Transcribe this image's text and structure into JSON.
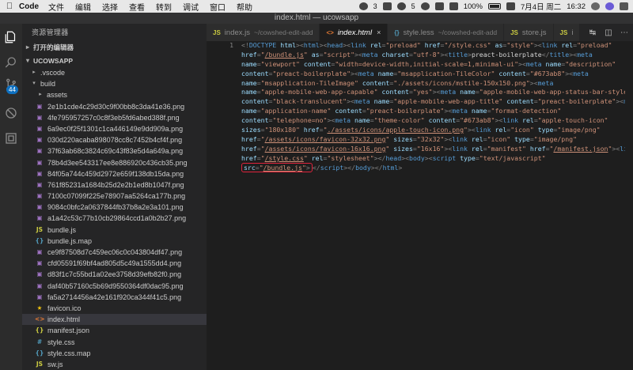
{
  "menubar": {
    "apple_icon": "apple-icon",
    "app_name": "Code",
    "items": [
      "文件",
      "编辑",
      "选择",
      "查看",
      "转到",
      "调试",
      "窗口",
      "帮助"
    ],
    "tray": {
      "qq_count": "3",
      "wechat_count": "5",
      "battery": "100%",
      "date": "7月4日 周二",
      "time": "16:32"
    }
  },
  "window": {
    "title": "index.html — ucowsapp"
  },
  "activitybar": {
    "scm_badge": "44"
  },
  "sidebar": {
    "title": "资源管理器",
    "open_editors": "打开的编辑器",
    "project": "UCOWSAPP",
    "tree": [
      {
        "label": ".vscode",
        "type": "folder",
        "depth": 1,
        "open": false
      },
      {
        "label": "build",
        "type": "folder",
        "depth": 1,
        "open": true
      },
      {
        "label": "assets",
        "type": "folder",
        "depth": 2,
        "open": false
      },
      {
        "label": "2e1b1cde4c29d30c9f00bb8c3da41e36.png",
        "type": "img",
        "depth": 2
      },
      {
        "label": "4fe795957257c0c8f3eb5fd6abed388f.png",
        "type": "img",
        "depth": 2
      },
      {
        "label": "6a9ec0f25f1301c1ca446149e9dd909a.png",
        "type": "img",
        "depth": 2
      },
      {
        "label": "030d220acaba898078cc8c7452b4cf4f.png",
        "type": "img",
        "depth": 2
      },
      {
        "label": "37f63ab68c3824c69c43f83e5d4a649a.png",
        "type": "img",
        "depth": 2
      },
      {
        "label": "78b4d3ee543317ee8e886920c436cb35.png",
        "type": "img",
        "depth": 2
      },
      {
        "label": "84f05a744c459d2972e659f138db15da.png",
        "type": "img",
        "depth": 2
      },
      {
        "label": "761f85231a1684b25d2e2b1ed8b1047f.png",
        "type": "img",
        "depth": 2
      },
      {
        "label": "7100c07099f225e78907aa5264ca177b.png",
        "type": "img",
        "depth": 2
      },
      {
        "label": "9084c0bfc2a0637844fb37b8a2e3a101.png",
        "type": "img",
        "depth": 2
      },
      {
        "label": "a1a42c53c77b10cb29864ccd1a0b2b27.png",
        "type": "img",
        "depth": 2
      },
      {
        "label": "bundle.js",
        "type": "js",
        "depth": 2
      },
      {
        "label": "bundle.js.map",
        "type": "map",
        "depth": 2
      },
      {
        "label": "ce9f87508d7c459ec06c0c043804df47.png",
        "type": "img",
        "depth": 2
      },
      {
        "label": "cfd05591f69bf4ad805d5c49a1555dd4.png",
        "type": "img",
        "depth": 2
      },
      {
        "label": "d83f1c7c55bd1a02ee3758d39efb82f0.png",
        "type": "img",
        "depth": 2
      },
      {
        "label": "daf40b57160c5b69d9550364df0dac95.png",
        "type": "img",
        "depth": 2
      },
      {
        "label": "fa5a2714456a42e161f920ca344f41c5.png",
        "type": "img",
        "depth": 2
      },
      {
        "label": "favicon.ico",
        "type": "star",
        "depth": 2
      },
      {
        "label": "index.html",
        "type": "html",
        "depth": 2,
        "selected": true
      },
      {
        "label": "manifest.json",
        "type": "json",
        "depth": 2
      },
      {
        "label": "style.css",
        "type": "css",
        "depth": 2
      },
      {
        "label": "style.css.map",
        "type": "map",
        "depth": 2
      },
      {
        "label": "sw.js",
        "type": "js",
        "depth": 2
      }
    ]
  },
  "tabs": [
    {
      "label": "index.js",
      "desc": "~/cowshed-edit-add",
      "icon": "JS",
      "active": false
    },
    {
      "label": "index.html",
      "desc": "",
      "icon": "<>",
      "active": true
    },
    {
      "label": "style.less",
      "desc": "~/cowshed-edit-add",
      "icon": "{}",
      "active": false
    },
    {
      "label": "store.js",
      "desc": "",
      "icon": "JS",
      "active": false
    },
    {
      "label": "i",
      "desc": "",
      "icon": "JS",
      "active": false
    }
  ],
  "editor": {
    "line_number": "1",
    "code_lines": [
      [
        [
          "p",
          "<!"
        ],
        [
          "t",
          "DOCTYPE"
        ],
        [
          "a",
          " html"
        ],
        [
          "p",
          ">"
        ],
        [
          "p",
          "<"
        ],
        [
          "t",
          "html"
        ],
        [
          "p",
          ">"
        ],
        [
          "p",
          "<"
        ],
        [
          "t",
          "head"
        ],
        [
          "p",
          ">"
        ],
        [
          "p",
          "<"
        ],
        [
          "t",
          "link"
        ],
        [
          "a",
          " rel"
        ],
        [
          "p",
          "="
        ],
        [
          "s",
          "\"preload\""
        ],
        [
          "a",
          " href"
        ],
        [
          "p",
          "="
        ],
        [
          "s",
          "\"/style.css\""
        ],
        [
          "a",
          " as"
        ],
        [
          "p",
          "="
        ],
        [
          "s",
          "\"style\""
        ],
        [
          "p",
          ">"
        ],
        [
          "p",
          "<"
        ],
        [
          "t",
          "link"
        ],
        [
          "a",
          " rel"
        ],
        [
          "p",
          "="
        ],
        [
          "s",
          "\"preload\""
        ]
      ],
      [
        [
          "a",
          "href"
        ],
        [
          "p",
          "="
        ],
        [
          "s",
          "\""
        ],
        [
          "u",
          "/bundle.js"
        ],
        [
          "s",
          "\""
        ],
        [
          "a",
          " as"
        ],
        [
          "p",
          "="
        ],
        [
          "s",
          "\"script\""
        ],
        [
          "p",
          ">"
        ],
        [
          "p",
          "<"
        ],
        [
          "t",
          "meta"
        ],
        [
          "a",
          " charset"
        ],
        [
          "p",
          "="
        ],
        [
          "s",
          "\"utf-8\""
        ],
        [
          "p",
          ">"
        ],
        [
          "p",
          "<"
        ],
        [
          "t",
          "title"
        ],
        [
          "p",
          ">"
        ],
        [
          "d",
          "preact-boilerplate"
        ],
        [
          "p",
          "</"
        ],
        [
          "t",
          "title"
        ],
        [
          "p",
          ">"
        ],
        [
          "p",
          "<"
        ],
        [
          "t",
          "meta"
        ]
      ],
      [
        [
          "a",
          "name"
        ],
        [
          "p",
          "="
        ],
        [
          "s",
          "\"viewport\""
        ],
        [
          "a",
          " content"
        ],
        [
          "p",
          "="
        ],
        [
          "s",
          "\"width=device-width,initial-scale=1,minimal-ui\""
        ],
        [
          "p",
          ">"
        ],
        [
          "p",
          "<"
        ],
        [
          "t",
          "meta"
        ],
        [
          "a",
          " name"
        ],
        [
          "p",
          "="
        ],
        [
          "s",
          "\"description\""
        ]
      ],
      [
        [
          "a",
          "content"
        ],
        [
          "p",
          "="
        ],
        [
          "s",
          "\"preact-boilerplate\""
        ],
        [
          "p",
          ">"
        ],
        [
          "p",
          "<"
        ],
        [
          "t",
          "meta"
        ],
        [
          "a",
          " name"
        ],
        [
          "p",
          "="
        ],
        [
          "s",
          "\"msapplication-TileColor\""
        ],
        [
          "a",
          " content"
        ],
        [
          "p",
          "="
        ],
        [
          "s",
          "\"#673ab8\""
        ],
        [
          "p",
          ">"
        ],
        [
          "p",
          "<"
        ],
        [
          "t",
          "meta"
        ]
      ],
      [
        [
          "a",
          "name"
        ],
        [
          "p",
          "="
        ],
        [
          "s",
          "\"msapplication-TileImage\""
        ],
        [
          "a",
          " content"
        ],
        [
          "p",
          "="
        ],
        [
          "s",
          "\"./assets/icons/mstile-150x150.png\""
        ],
        [
          "p",
          ">"
        ],
        [
          "p",
          "<"
        ],
        [
          "t",
          "meta"
        ]
      ],
      [
        [
          "a",
          "name"
        ],
        [
          "p",
          "="
        ],
        [
          "s",
          "\"apple-mobile-web-app-capable\""
        ],
        [
          "a",
          " content"
        ],
        [
          "p",
          "="
        ],
        [
          "s",
          "\"yes\""
        ],
        [
          "p",
          ">"
        ],
        [
          "p",
          "<"
        ],
        [
          "t",
          "meta"
        ],
        [
          "a",
          " name"
        ],
        [
          "p",
          "="
        ],
        [
          "s",
          "\"apple-mobile-web-app-status-bar-style\""
        ]
      ],
      [
        [
          "a",
          "content"
        ],
        [
          "p",
          "="
        ],
        [
          "s",
          "\"black-translucent\""
        ],
        [
          "p",
          ">"
        ],
        [
          "p",
          "<"
        ],
        [
          "t",
          "meta"
        ],
        [
          "a",
          " name"
        ],
        [
          "p",
          "="
        ],
        [
          "s",
          "\"apple-mobile-web-app-title\""
        ],
        [
          "a",
          " content"
        ],
        [
          "p",
          "="
        ],
        [
          "s",
          "\"preact-boilerplate\""
        ],
        [
          "p",
          ">"
        ],
        [
          "p",
          "<"
        ],
        [
          "t",
          "meta"
        ]
      ],
      [
        [
          "a",
          "name"
        ],
        [
          "p",
          "="
        ],
        [
          "s",
          "\"application-name\""
        ],
        [
          "a",
          " content"
        ],
        [
          "p",
          "="
        ],
        [
          "s",
          "\"preact-boilerplate\""
        ],
        [
          "p",
          ">"
        ],
        [
          "p",
          "<"
        ],
        [
          "t",
          "meta"
        ],
        [
          "a",
          " name"
        ],
        [
          "p",
          "="
        ],
        [
          "s",
          "\"format-detection\""
        ]
      ],
      [
        [
          "a",
          "content"
        ],
        [
          "p",
          "="
        ],
        [
          "s",
          "\"telephone=no\""
        ],
        [
          "p",
          ">"
        ],
        [
          "p",
          "<"
        ],
        [
          "t",
          "meta"
        ],
        [
          "a",
          " name"
        ],
        [
          "p",
          "="
        ],
        [
          "s",
          "\"theme-color\""
        ],
        [
          "a",
          " content"
        ],
        [
          "p",
          "="
        ],
        [
          "s",
          "\"#673ab8\""
        ],
        [
          "p",
          ">"
        ],
        [
          "p",
          "<"
        ],
        [
          "t",
          "link"
        ],
        [
          "a",
          " rel"
        ],
        [
          "p",
          "="
        ],
        [
          "s",
          "\"apple-touch-icon\""
        ]
      ],
      [
        [
          "a",
          "sizes"
        ],
        [
          "p",
          "="
        ],
        [
          "s",
          "\"180x180\""
        ],
        [
          "a",
          " href"
        ],
        [
          "p",
          "="
        ],
        [
          "s",
          "\""
        ],
        [
          "u",
          "./assets/icons/apple-touch-icon.png"
        ],
        [
          "s",
          "\""
        ],
        [
          "p",
          ">"
        ],
        [
          "p",
          "<"
        ],
        [
          "t",
          "link"
        ],
        [
          "a",
          " rel"
        ],
        [
          "p",
          "="
        ],
        [
          "s",
          "\"icon\""
        ],
        [
          "a",
          " type"
        ],
        [
          "p",
          "="
        ],
        [
          "s",
          "\"image/png\""
        ]
      ],
      [
        [
          "a",
          "href"
        ],
        [
          "p",
          "="
        ],
        [
          "s",
          "\""
        ],
        [
          "u",
          "/assets/icons/favicon-32x32.png"
        ],
        [
          "s",
          "\""
        ],
        [
          "a",
          " sizes"
        ],
        [
          "p",
          "="
        ],
        [
          "s",
          "\"32x32\""
        ],
        [
          "p",
          ">"
        ],
        [
          "p",
          "<"
        ],
        [
          "t",
          "link"
        ],
        [
          "a",
          " rel"
        ],
        [
          "p",
          "="
        ],
        [
          "s",
          "\"icon\""
        ],
        [
          "a",
          " type"
        ],
        [
          "p",
          "="
        ],
        [
          "s",
          "\"image/png\""
        ]
      ],
      [
        [
          "a",
          "href"
        ],
        [
          "p",
          "="
        ],
        [
          "s",
          "\""
        ],
        [
          "u",
          "/assets/icons/favicon-16x16.png"
        ],
        [
          "s",
          "\""
        ],
        [
          "a",
          " sizes"
        ],
        [
          "p",
          "="
        ],
        [
          "s",
          "\"16x16\""
        ],
        [
          "p",
          ">"
        ],
        [
          "p",
          "<"
        ],
        [
          "t",
          "link"
        ],
        [
          "a",
          " rel"
        ],
        [
          "p",
          "="
        ],
        [
          "s",
          "\"manifest\""
        ],
        [
          "a",
          " href"
        ],
        [
          "p",
          "="
        ],
        [
          "s",
          "\""
        ],
        [
          "u",
          "/manifest.json"
        ],
        [
          "s",
          "\""
        ],
        [
          "p",
          ">"
        ],
        [
          "p",
          "<"
        ],
        [
          "t",
          "link"
        ]
      ],
      [
        [
          "a",
          "href"
        ],
        [
          "p",
          "="
        ],
        [
          "s",
          "\""
        ],
        [
          "u",
          "/style.css"
        ],
        [
          "s",
          "\""
        ],
        [
          "a",
          " rel"
        ],
        [
          "p",
          "="
        ],
        [
          "s",
          "\"stylesheet\""
        ],
        [
          "p",
          ">"
        ],
        [
          "p",
          "</"
        ],
        [
          "t",
          "head"
        ],
        [
          "p",
          ">"
        ],
        [
          "p",
          "<"
        ],
        [
          "t",
          "body"
        ],
        [
          "p",
          ">"
        ],
        [
          "p",
          "<"
        ],
        [
          "t",
          "script"
        ],
        [
          "a",
          " type"
        ],
        [
          "p",
          "="
        ],
        [
          "s",
          "\"text/javascript\""
        ]
      ],
      [
        [
          "H",
          ""
        ],
        [
          "a",
          "src"
        ],
        [
          "p",
          "="
        ],
        [
          "s",
          "\""
        ],
        [
          "u",
          "/bundle.js"
        ],
        [
          "s",
          "\""
        ],
        [
          "p",
          ">"
        ],
        [
          "E",
          ""
        ],
        [
          "p",
          "</"
        ],
        [
          "t",
          "script"
        ],
        [
          "p",
          ">"
        ],
        [
          "p",
          "</"
        ],
        [
          "t",
          "body"
        ],
        [
          "p",
          ">"
        ],
        [
          "p",
          "</"
        ],
        [
          "t",
          "html"
        ],
        [
          "p",
          ">"
        ]
      ]
    ]
  },
  "colors": {
    "editor_bg": "#1e1e1e",
    "sidebar_bg": "#252526",
    "tag": "#569cd6",
    "attr": "#9cdcfe",
    "string": "#ce9178",
    "highlight_box": "#e0233c",
    "badge": "#0e70c0"
  }
}
